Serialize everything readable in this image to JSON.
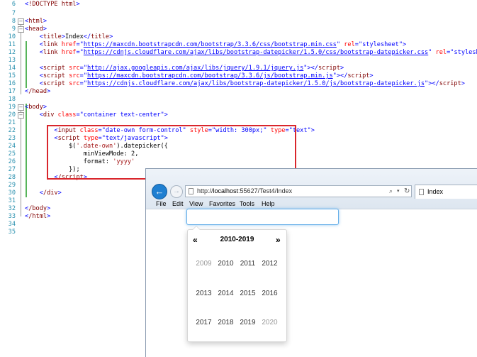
{
  "editor": {
    "lines": [
      {
        "num": "6"
      },
      {
        "num": "7"
      },
      {
        "num": "8"
      },
      {
        "num": "9"
      },
      {
        "num": "10"
      },
      {
        "num": "11"
      },
      {
        "num": "12"
      },
      {
        "num": "13"
      },
      {
        "num": "14"
      },
      {
        "num": "15"
      },
      {
        "num": "16"
      },
      {
        "num": "17"
      },
      {
        "num": "18"
      },
      {
        "num": "19"
      },
      {
        "num": "20"
      },
      {
        "num": "21"
      },
      {
        "num": "22"
      },
      {
        "num": "23"
      },
      {
        "num": "24"
      },
      {
        "num": "25"
      },
      {
        "num": "26"
      },
      {
        "num": "27"
      },
      {
        "num": "28"
      },
      {
        "num": "29"
      },
      {
        "num": "30"
      },
      {
        "num": "31"
      },
      {
        "num": "32"
      },
      {
        "num": "33"
      },
      {
        "num": "34"
      },
      {
        "num": "35"
      }
    ],
    "code": {
      "l6": "!DOCTYPE html",
      "l8": "html",
      "l9": "head",
      "l10_title": "title",
      "l10_text": "Index",
      "l11_link": "link",
      "l11_href": "href",
      "l11_url": "https://maxcdn.bootstrapcdn.com/bootstrap/3.3.6/css/bootstrap.min.css",
      "l11_rel": "rel",
      "l11_relv": "\"stylesheet\"",
      "l12_url": "https://cdnjs.cloudflare.com/ajax/libs/bootstrap-datepicker/1.5.0/css/bootstrap-datepicker.css",
      "l14_script": "script",
      "l14_src": "src",
      "l14_url": "http://ajax.googleapis.com/ajax/libs/jquery/1.9.1/jquery.js",
      "l15_url": "https://maxcdn.bootstrapcdn.com/bootstrap/3.3.6/js/bootstrap.min.js",
      "l16_url": "https://cdnjs.cloudflare.com/ajax/libs/bootstrap-datepicker/1.5.0/js/bootstrap-datepicker.js",
      "l17": "/head",
      "l19": "body",
      "l20_div": "div",
      "l20_class": "class",
      "l20_val": "\"container text-center\"",
      "l22_input": "input",
      "l22_class": "class",
      "l22_classv": "\"date-own form-control\"",
      "l22_style": "style",
      "l22_stylev": "\"width: 300px;\"",
      "l22_type": "type",
      "l22_typev": "\"text\"",
      "l23_script": "script",
      "l23_type": "type",
      "l23_typev": "\"text/javascript\"",
      "l24_a": "$(",
      "l24_str": "'.date-own'",
      "l24_b": ").datepicker({",
      "l25": "minViewMode: 2,",
      "l26_a": "format: ",
      "l26_str": "'yyyy'",
      "l27": "});",
      "l28": "/script",
      "l30": "/div",
      "l32": "/body",
      "l33": "/html"
    }
  },
  "browser": {
    "address_prefix": "http://",
    "address_host": "localhost",
    "address_rest": ":55627/Test4/Index",
    "tab_label": "Index",
    "menu": [
      "File",
      "Edit",
      "View",
      "Favorites",
      "Tools",
      "Help"
    ],
    "icons": [
      "back-arrow-icon",
      "forward-arrow-icon",
      "search-icon",
      "refresh-icon",
      "page-icon"
    ]
  },
  "datepicker": {
    "prev": "«",
    "next": "»",
    "title": "2010-2019",
    "years": [
      {
        "label": "2009",
        "old": true
      },
      {
        "label": "2010",
        "old": false
      },
      {
        "label": "2011",
        "old": false
      },
      {
        "label": "2012",
        "old": false
      },
      {
        "label": "2013",
        "old": false
      },
      {
        "label": "2014",
        "old": false
      },
      {
        "label": "2015",
        "old": false
      },
      {
        "label": "2016",
        "old": false
      },
      {
        "label": "2017",
        "old": false
      },
      {
        "label": "2018",
        "old": false
      },
      {
        "label": "2019",
        "old": false
      },
      {
        "label": "2020",
        "old": true
      }
    ]
  },
  "colors": {
    "highlight_border": "#d9262c",
    "change_bar": "#57b45a",
    "line_numbers": "#2b91af"
  }
}
